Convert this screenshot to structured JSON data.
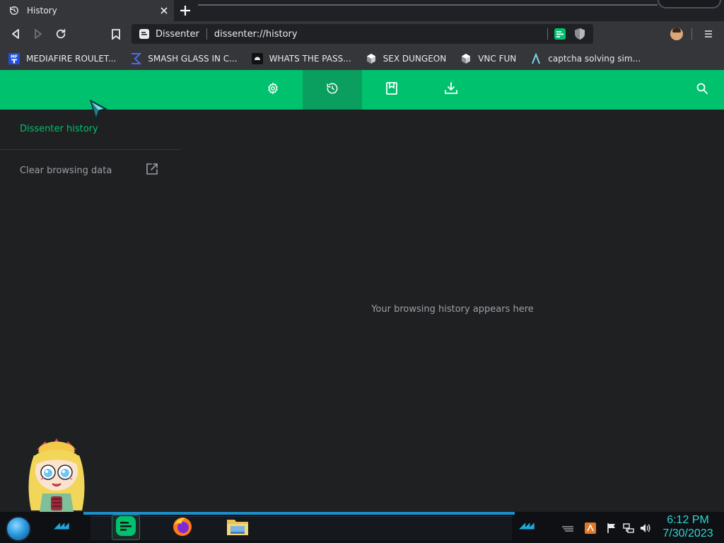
{
  "tab": {
    "title": "History",
    "icon": "history-icon"
  },
  "omnibox": {
    "site_name": "Dissenter",
    "url": "dissenter://history"
  },
  "bookmarks": [
    {
      "label": "MEDIAFIRE ROULET...",
      "icon": "mediafire-icon"
    },
    {
      "label": "SMASH GLASS IN C...",
      "icon": "sigma-icon"
    },
    {
      "label": "WHATS THE PASS...",
      "icon": "discord-icon"
    },
    {
      "label": "SEX DUNGEON",
      "icon": "cube-icon"
    },
    {
      "label": "VNC FUN",
      "icon": "cube-icon"
    },
    {
      "label": "captcha solving sim...",
      "icon": "lambda-icon"
    }
  ],
  "sidebar": {
    "title": "Dissenter history",
    "clear_label": "Clear browsing data"
  },
  "main": {
    "empty_message": "Your browsing history appears here"
  },
  "taskbar": {
    "time": "6:12 PM",
    "date": "7/30/2023"
  },
  "colors": {
    "accent": "#00c26e",
    "accent_dark": "#0a9e5f",
    "background": "#1e2022",
    "clock": "#2dd6d6"
  }
}
